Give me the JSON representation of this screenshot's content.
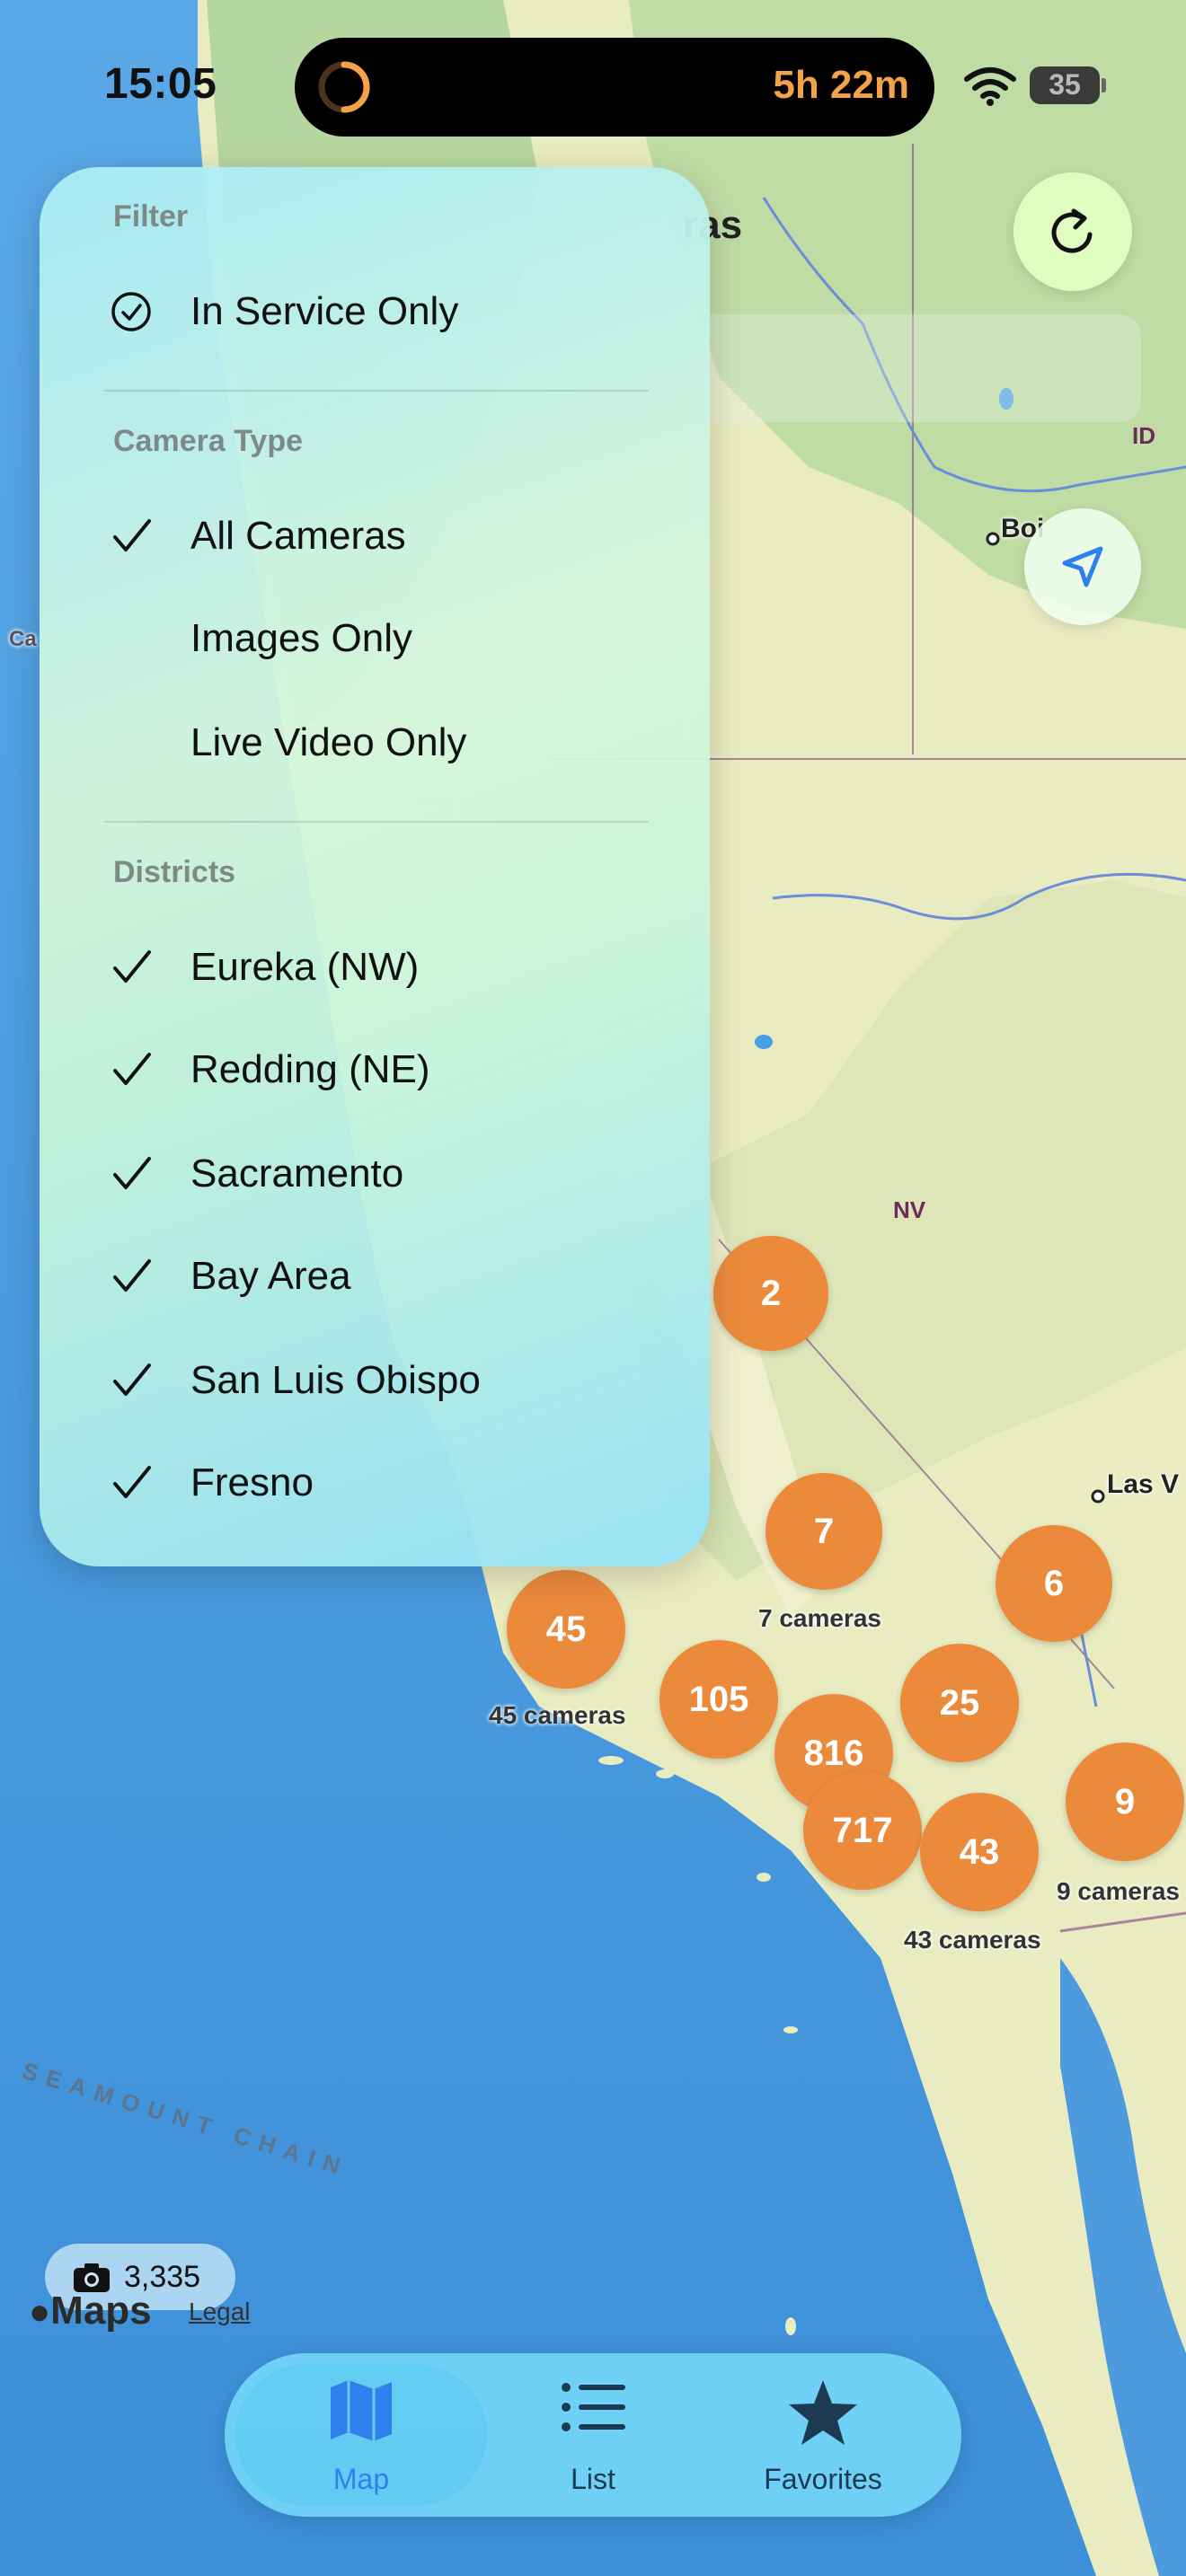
{
  "status_bar": {
    "time": "15:05",
    "live_activity_timer": "5h 22m",
    "battery": "35"
  },
  "header": {
    "title_visible_fragment": "ras"
  },
  "colors": {
    "cluster": "#ec8a3c",
    "accent_tab": "#2f80ed",
    "menu_tint": "#c8f0e6"
  },
  "map": {
    "state_labels": [
      "ID",
      "NV"
    ],
    "city_labels": [
      "Boi",
      "Las V",
      "Ca"
    ],
    "seamount_label": "SEAMOUNT CHAIN",
    "clusters": [
      {
        "count": "2"
      },
      {
        "count": "7",
        "caption": "7 cameras"
      },
      {
        "count": "6"
      },
      {
        "count": "45",
        "caption": "45 cameras"
      },
      {
        "count": "105"
      },
      {
        "count": "25"
      },
      {
        "count": "816"
      },
      {
        "count": "717"
      },
      {
        "count": "43",
        "caption": "43 cameras"
      },
      {
        "count": "9",
        "caption": "9 cameras"
      }
    ]
  },
  "filter_menu": {
    "filter_heading": "Filter",
    "in_service": {
      "label": "In Service Only",
      "icon": "checkmark-circle-icon",
      "checked": true
    },
    "camera_type_heading": "Camera Type",
    "camera_types": [
      {
        "label": "All Cameras",
        "checked": true
      },
      {
        "label": "Images Only",
        "checked": false
      },
      {
        "label": "Live Video Only",
        "checked": false
      }
    ],
    "districts_heading": "Districts",
    "districts": [
      {
        "label": "Eureka (NW)",
        "checked": true
      },
      {
        "label": "Redding (NE)",
        "checked": true
      },
      {
        "label": "Sacramento",
        "checked": true
      },
      {
        "label": "Bay Area",
        "checked": true
      },
      {
        "label": "San Luis Obispo",
        "checked": true
      },
      {
        "label": "Fresno",
        "checked": true
      }
    ]
  },
  "camera_count": "3,335",
  "attribution": {
    "maps": "Maps",
    "legal": "Legal"
  },
  "tabs": [
    {
      "label": "Map",
      "icon": "map-icon",
      "selected": true
    },
    {
      "label": "List",
      "icon": "list-icon",
      "selected": false
    },
    {
      "label": "Favorites",
      "icon": "star-icon",
      "selected": false
    }
  ]
}
